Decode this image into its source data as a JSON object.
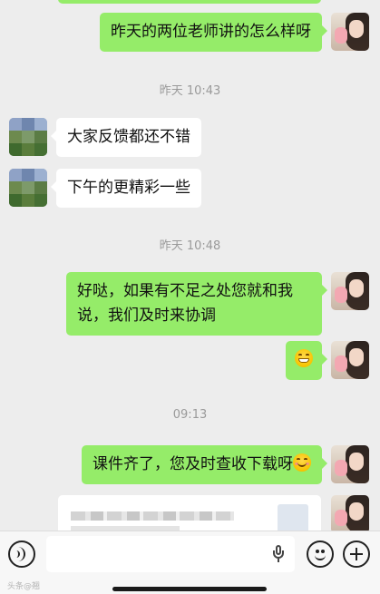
{
  "messages": [
    {
      "side": "right",
      "text": "昨天的两位老师讲的怎么样呀"
    },
    {
      "side": "left",
      "text": "大家反馈都还不错"
    },
    {
      "side": "left",
      "text": "下午的更精彩一些"
    },
    {
      "side": "right",
      "text": "好哒，如果有不足之处您就和我说，我们及时来协调"
    },
    {
      "side": "right",
      "emoji": "grinning-face"
    },
    {
      "side": "right",
      "text": "课件齐了，您及时查收下载呀",
      "emoji": "smiling-face"
    }
  ],
  "timestamps": [
    "昨天 10:43",
    "昨天 10:48",
    "09:13"
  ],
  "input": {
    "placeholder": ""
  },
  "watermark": "头条@翘",
  "colors": {
    "self_bubble": "#95ec69",
    "other_bubble": "#ffffff",
    "background": "#ededed"
  },
  "icons": {
    "voice": "voice-icon",
    "mic": "microphone-icon",
    "emoji": "emoji-icon",
    "more": "plus-icon"
  }
}
